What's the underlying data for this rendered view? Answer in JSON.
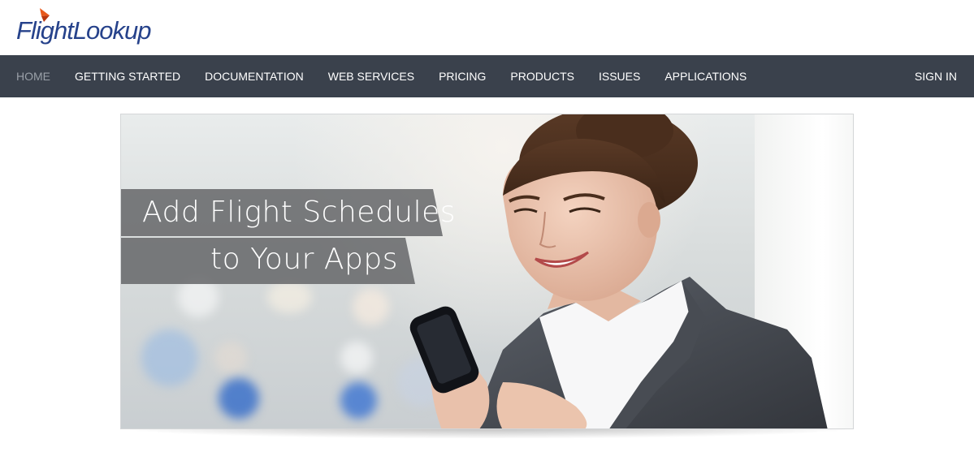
{
  "header": {
    "logo_text": "FlightLookup"
  },
  "nav": {
    "items": [
      {
        "label": "HOME",
        "active": true
      },
      {
        "label": "GETTING STARTED"
      },
      {
        "label": "DOCUMENTATION"
      },
      {
        "label": "WEB SERVICES"
      },
      {
        "label": "PRICING"
      },
      {
        "label": "PRODUCTS"
      },
      {
        "label": "ISSUES"
      },
      {
        "label": "APPLICATIONS"
      }
    ],
    "sign_in": "SIGN IN"
  },
  "hero": {
    "line1": "Add Flight Schedules",
    "line2": "to Your Apps"
  },
  "colors": {
    "nav_background": "#3a414c",
    "logo_blue": "#26428b",
    "logo_accent": "#e8591c",
    "nav_active": "#9aa0a8"
  },
  "icons": {
    "logo_mark": "flight-arrow-icon"
  }
}
